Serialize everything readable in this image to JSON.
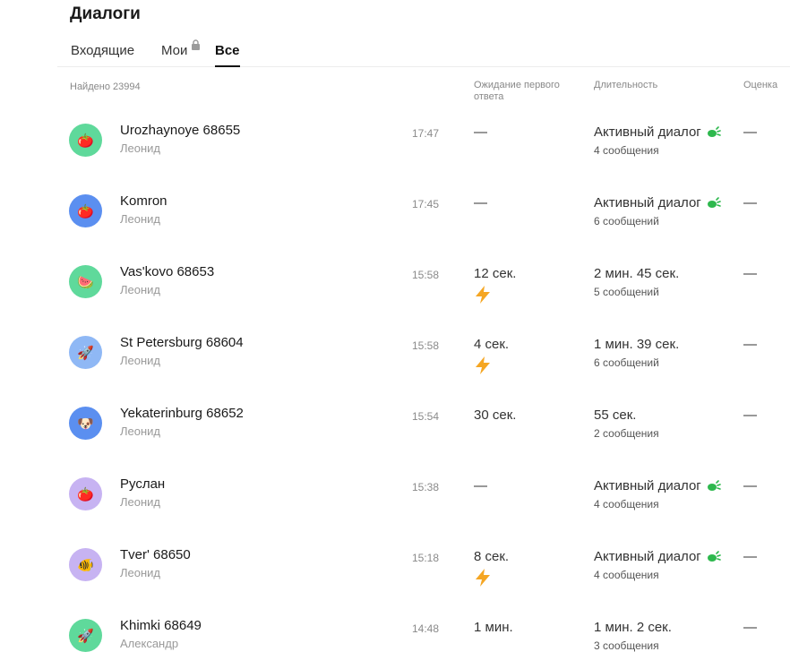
{
  "header": {
    "title": "Диалоги"
  },
  "tabs": [
    {
      "label": "Входящие",
      "locked": true
    },
    {
      "label": "Мои"
    },
    {
      "label": "Все",
      "active": true
    }
  ],
  "list": {
    "found": "Найдено 23994",
    "columns": {
      "wait": "Ожидание первого ответа",
      "duration": "Длительность",
      "rating": "Оценка"
    }
  },
  "dialogs": [
    {
      "name": "Urozhaynoye 68655",
      "operator": "Леонид",
      "time": "17:47",
      "wait": "—",
      "fast": false,
      "duration": "Активный диалог",
      "active": true,
      "messages": "4 сообщения",
      "rating": "—",
      "avatar_icon": "tomato-icon",
      "avatar_glyph": "🍅",
      "avatar_color": "#5fd99b"
    },
    {
      "name": "Komron",
      "operator": "Леонид",
      "time": "17:45",
      "wait": "—",
      "fast": false,
      "duration": "Активный диалог",
      "active": true,
      "messages": "6 сообщений",
      "rating": "—",
      "avatar_icon": "tomato-icon",
      "avatar_glyph": "🍅",
      "avatar_color": "#5b8ff0"
    },
    {
      "name": "Vas'kovo 68653",
      "operator": "Леонид",
      "time": "15:58",
      "wait": "12 сек.",
      "fast": true,
      "duration": "2 мин. 45 сек.",
      "active": false,
      "messages": "5 сообщений",
      "rating": "—",
      "avatar_icon": "watermelon-icon",
      "avatar_glyph": "🍉",
      "avatar_color": "#5fd99b"
    },
    {
      "name": "St Petersburg 68604",
      "operator": "Леонид",
      "time": "15:58",
      "wait": "4 сек.",
      "fast": true,
      "duration": "1 мин. 39 сек.",
      "active": false,
      "messages": "6 сообщений",
      "rating": "—",
      "avatar_icon": "rocket-icon",
      "avatar_glyph": "🚀",
      "avatar_color": "#8fb8f5"
    },
    {
      "name": "Yekaterinburg 68652",
      "operator": "Леонид",
      "time": "15:54",
      "wait": "30 сек.",
      "fast": false,
      "duration": "55 сек.",
      "active": false,
      "messages": "2 сообщения",
      "rating": "—",
      "avatar_icon": "dog-icon",
      "avatar_glyph": "🐶",
      "avatar_color": "#5b8ff0"
    },
    {
      "name": "Руслан",
      "operator": "Леонид",
      "time": "15:38",
      "wait": "—",
      "fast": false,
      "duration": "Активный диалог",
      "active": true,
      "messages": "4 сообщения",
      "rating": "—",
      "avatar_icon": "tomato-icon",
      "avatar_glyph": "🍅",
      "avatar_color": "#c7b3f2"
    },
    {
      "name": "Tver' 68650",
      "operator": "Леонид",
      "time": "15:18",
      "wait": "8 сек.",
      "fast": true,
      "duration": "Активный диалог",
      "active": true,
      "messages": "4 сообщения",
      "rating": "—",
      "avatar_icon": "fish-icon",
      "avatar_glyph": "🐠",
      "avatar_color": "#c7b3f2"
    },
    {
      "name": "Khimki 68649",
      "operator": "Александр",
      "time": "14:48",
      "wait": "1 мин.",
      "fast": false,
      "duration": "1 мин. 2 сек.",
      "active": false,
      "messages": "3 сообщения",
      "rating": "—",
      "avatar_icon": "rocket-icon",
      "avatar_glyph": "🚀",
      "avatar_color": "#5fd99b"
    }
  ],
  "colors": {
    "bolt": "#f5a623",
    "active_leaf": "#2db84d",
    "tab_underline": "#111111"
  }
}
